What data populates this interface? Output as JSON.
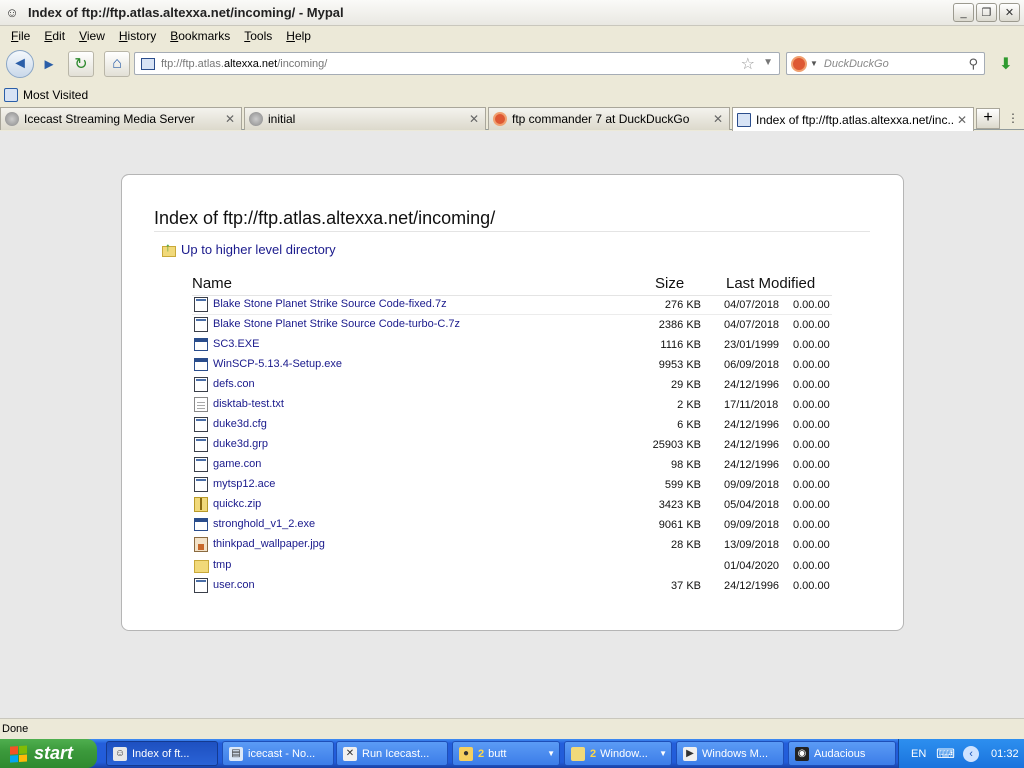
{
  "window": {
    "title": "Index of ftp://ftp.atlas.altexxa.net/incoming/ - Mypal",
    "controls": [
      "_",
      "❐",
      "✕"
    ]
  },
  "menu": {
    "items": [
      {
        "label": "File",
        "key": "F",
        "rest": "ile"
      },
      {
        "label": "Edit",
        "key": "E",
        "rest": "dit"
      },
      {
        "label": "View",
        "key": "V",
        "rest": "iew"
      },
      {
        "label": "History",
        "key": "H",
        "rest": "istory"
      },
      {
        "label": "Bookmarks",
        "key": "B",
        "rest": "ookmarks"
      },
      {
        "label": "Tools",
        "key": "T",
        "rest": "ools"
      },
      {
        "label": "Help",
        "key": "H",
        "rest": "elp"
      }
    ]
  },
  "navbar": {
    "url_prefix": "ftp://ftp.atlas.",
    "url_host": "altexxa.net",
    "url_suffix": "/incoming/",
    "search_placeholder": "DuckDuckGo"
  },
  "bookmarks": {
    "most_visited": "Most Visited"
  },
  "tabs": [
    {
      "label": "Icecast Streaming Media Server",
      "icon": "globe"
    },
    {
      "label": "initial",
      "icon": "globe"
    },
    {
      "label": "ftp commander 7 at DuckDuckGo",
      "icon": "ddg"
    },
    {
      "label": "Index of ftp://ftp.atlas.altexxa.net/inc...",
      "icon": "ftp",
      "active": true
    }
  ],
  "page": {
    "heading": "Index of ftp://ftp.atlas.altexxa.net/incoming/",
    "up_link": "Up to higher level directory",
    "columns": {
      "name": "Name",
      "size": "Size",
      "modified": "Last Modified"
    },
    "files": [
      {
        "name": "Blake Stone Planet Strike Source Code-fixed.7z",
        "size": "276 KB",
        "date": "04/07/2018",
        "time": "0.00.00",
        "icon": "bin"
      },
      {
        "name": "Blake Stone Planet Strike Source Code-turbo-C.7z",
        "size": "2386 KB",
        "date": "04/07/2018",
        "time": "0.00.00",
        "icon": "bin"
      },
      {
        "name": "SC3.EXE",
        "size": "1116 KB",
        "date": "23/01/1999",
        "time": "0.00.00",
        "icon": "exe"
      },
      {
        "name": "WinSCP-5.13.4-Setup.exe",
        "size": "9953 KB",
        "date": "06/09/2018",
        "time": "0.00.00",
        "icon": "exe"
      },
      {
        "name": "defs.con",
        "size": "29 KB",
        "date": "24/12/1996",
        "time": "0.00.00",
        "icon": "bin"
      },
      {
        "name": "disktab-test.txt",
        "size": "2 KB",
        "date": "17/11/2018",
        "time": "0.00.00",
        "icon": "txt"
      },
      {
        "name": "duke3d.cfg",
        "size": "6 KB",
        "date": "24/12/1996",
        "time": "0.00.00",
        "icon": "bin"
      },
      {
        "name": "duke3d.grp",
        "size": "25903 KB",
        "date": "24/12/1996",
        "time": "0.00.00",
        "icon": "bin"
      },
      {
        "name": "game.con",
        "size": "98 KB",
        "date": "24/12/1996",
        "time": "0.00.00",
        "icon": "bin"
      },
      {
        "name": "mytsp12.ace",
        "size": "599 KB",
        "date": "09/09/2018",
        "time": "0.00.00",
        "icon": "bin"
      },
      {
        "name": "quickc.zip",
        "size": "3423 KB",
        "date": "05/04/2018",
        "time": "0.00.00",
        "icon": "zip"
      },
      {
        "name": "stronghold_v1_2.exe",
        "size": "9061 KB",
        "date": "09/09/2018",
        "time": "0.00.00",
        "icon": "exe"
      },
      {
        "name": "thinkpad_wallpaper.jpg",
        "size": "28 KB",
        "date": "13/09/2018",
        "time": "0.00.00",
        "icon": "img"
      },
      {
        "name": "tmp",
        "size": "",
        "date": "01/04/2020",
        "time": "0.00.00",
        "icon": "folder"
      },
      {
        "name": "user.con",
        "size": "37 KB",
        "date": "24/12/1996",
        "time": "0.00.00",
        "icon": "bin"
      }
    ]
  },
  "status": {
    "text": "Done"
  },
  "taskbar": {
    "start_label": "start",
    "tasks": [
      {
        "label": "Index of ft...",
        "active": true,
        "icon": "browser-icon"
      },
      {
        "label": "icecast - No...",
        "icon": "notepad-icon"
      },
      {
        "label": "Run Icecast...",
        "icon": "x-icon"
      },
      {
        "count": "2",
        "label": "butt",
        "icon": "butt-icon",
        "has_arrow": true
      },
      {
        "count": "2",
        "label": "Window...",
        "icon": "folder-icon",
        "has_arrow": true
      },
      {
        "label": "Windows M...",
        "icon": "media-player-icon"
      },
      {
        "label": "Audacious",
        "icon": "audacious-icon"
      }
    ],
    "tray": {
      "language": "EN",
      "clock": "01:32"
    }
  },
  "colors": {
    "link": "#1a1a8c",
    "taskbar": "#245edb",
    "start": "#3c9a3c",
    "content_bg": "#e8e8e8"
  }
}
